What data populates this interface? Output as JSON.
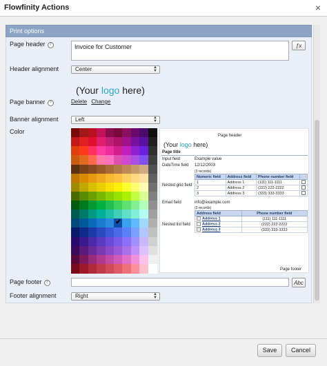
{
  "window": {
    "title": "Flowfinity Actions",
    "close_glyph": "×"
  },
  "section": {
    "title": "Print options"
  },
  "fields": {
    "page_header": {
      "label": "Page header",
      "value": "Invoice for Customer",
      "fx_label": "ƒx"
    },
    "header_alignment": {
      "label": "Header alignment",
      "value": "Center"
    },
    "page_banner": {
      "label": "Page banner",
      "logo_prefix": "(Your ",
      "logo_accent": "logo",
      "logo_suffix": " here)",
      "delete_label": "Delete",
      "change_label": "Change"
    },
    "banner_alignment": {
      "label": "Banner alignment",
      "value": "Left"
    },
    "color": {
      "label": "Color",
      "selected_color": "#0b4fa8"
    },
    "page_footer": {
      "label": "Page footer",
      "value": "",
      "abc_label": "Abc"
    },
    "footer_alignment": {
      "label": "Footer alignment",
      "value": "Right"
    }
  },
  "preview": {
    "page_header": "Page header",
    "logo_prefix": "(Your ",
    "logo_accent": "logo",
    "logo_suffix": " here)",
    "page_title": "Page title",
    "input_field_label": "Input field",
    "input_field_value": "Example value",
    "datetime_label": "DateTime field",
    "datetime_value": "12/12/2003",
    "records_count": "(3 records)",
    "nested_grid_label": "Nested grid field",
    "grid_headers": [
      "Numeric field",
      "Address field",
      "Phone number field"
    ],
    "grid_rows": [
      [
        "1",
        "Address 1",
        "(111) 111-1111"
      ],
      [
        "2",
        "Address 2",
        "(222) 222-2222"
      ],
      [
        "3",
        "Address 3",
        "(333) 333-3333"
      ]
    ],
    "email_label": "Email field",
    "email_value": "info@example.com",
    "nested_list_label": "Nested list field",
    "list_headers": [
      "Address field",
      "Phone number field"
    ],
    "list_rows": [
      [
        "Address 1",
        "(111) 111-1111"
      ],
      [
        "Address 2",
        "(222) 222-2222"
      ],
      [
        "Address 3",
        "(333) 333-3333"
      ]
    ],
    "page_footer": "Page footer"
  },
  "palette": {
    "columns": 10,
    "rows": [
      [
        "#7a0a0a",
        "#a31818",
        "#b8101e",
        "#c2125a",
        "#8a0e4e",
        "#7a0a3a",
        "#8a1060",
        "#6a0a6e",
        "#4a0a6e",
        "#101010"
      ],
      [
        "#c41818",
        "#e02020",
        "#e0102a",
        "#e01e6a",
        "#c01e76",
        "#b0126a",
        "#a0128a",
        "#7a10a0",
        "#5a10a0",
        "#202020"
      ],
      [
        "#e04010",
        "#ff3a1a",
        "#ff3060",
        "#ff3aa0",
        "#ee2e9e",
        "#d0208e",
        "#c020c0",
        "#9020d0",
        "#6a20e0",
        "#303030"
      ],
      [
        "#cc5a10",
        "#e06a20",
        "#ff6a4a",
        "#ff7aa8",
        "#ff70c0",
        "#e050b0",
        "#d04ad0",
        "#aa50e0",
        "#8050f0",
        "#404040"
      ],
      [
        "#5a3210",
        "#7a4218",
        "#8a4a20",
        "#9a5a28",
        "#aa6a38",
        "#b27a48",
        "#c08a58",
        "#c89a68",
        "#d0aa80",
        "#505050"
      ],
      [
        "#c07800",
        "#d88a00",
        "#e89a10",
        "#f0a820",
        "#f8b830",
        "#ffc040",
        "#ffd060",
        "#ffd880",
        "#ffe0a0",
        "#606060"
      ],
      [
        "#a08a00",
        "#c0a800",
        "#d8c000",
        "#e8d000",
        "#f8e000",
        "#fff000",
        "#ffff30",
        "#ffff70",
        "#ffffb0",
        "#707070"
      ],
      [
        "#4a6a00",
        "#5a8a00",
        "#6aa000",
        "#7ab800",
        "#8ad000",
        "#9ae000",
        "#aaf000",
        "#c0ff40",
        "#d8ff90",
        "#808080"
      ],
      [
        "#005a10",
        "#007a20",
        "#009a30",
        "#00b040",
        "#20c050",
        "#40d060",
        "#60e070",
        "#80f090",
        "#b0ffb8",
        "#909090"
      ],
      [
        "#005a50",
        "#007a6a",
        "#009a80",
        "#00b098",
        "#20c0a8",
        "#40d0b8",
        "#60e0c8",
        "#80f0d8",
        "#b0fff0",
        "#a0a0a0"
      ],
      [
        "#004a7a",
        "#005a9a",
        "#0a6ab8",
        "#1a7ad0",
        "#2a8ae0",
        "#0b4fa8",
        "#3aa0f0",
        "#60b8ff",
        "#a0d8ff",
        "#b0b0b0"
      ],
      [
        "#0a1a6a",
        "#102a8a",
        "#1a3aa8",
        "#2a4ac0",
        "#3a5ad8",
        "#4a6ae8",
        "#5a80f8",
        "#7aa0ff",
        "#b0c8ff",
        "#c0c0c0"
      ],
      [
        "#2a0a6a",
        "#3a1a8a",
        "#4a2aa8",
        "#5a3ac0",
        "#6a4ad8",
        "#7a5ae8",
        "#8a70f8",
        "#a090ff",
        "#c8b8ff",
        "#d0d0d0"
      ],
      [
        "#3a0a5a",
        "#5a1a7a",
        "#6a2a9a",
        "#7a3ab0",
        "#8a4ac8",
        "#9a5ad8",
        "#aa70e8",
        "#c090f8",
        "#dcc0ff",
        "#e0e0e0"
      ],
      [
        "#5a0a3a",
        "#7a1a5a",
        "#9a2a7a",
        "#b03a90",
        "#c04aa8",
        "#d05ab8",
        "#e070c8",
        "#f090d8",
        "#ffc0ec",
        "#f0f0f0"
      ],
      [
        "#7a0a1a",
        "#9a1a2a",
        "#b02a3a",
        "#c03a4a",
        "#d04a5a",
        "#e05a6a",
        "#f0707a",
        "#ff909a",
        "#ffc0c8",
        "#ffffff"
      ]
    ]
  },
  "buttons": {
    "save": "Save",
    "cancel": "Cancel"
  }
}
